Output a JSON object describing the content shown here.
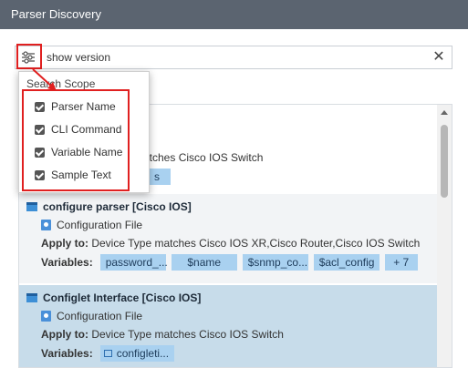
{
  "window": {
    "title": "Parser Discovery"
  },
  "search": {
    "value": "show version",
    "placeholder": ""
  },
  "scope_menu": {
    "title": "Search Scope",
    "options": [
      {
        "label": "Parser Name",
        "checked": true
      },
      {
        "label": "CLI Command",
        "checked": true
      },
      {
        "label": "Variable Name",
        "checked": true
      },
      {
        "label": "Sample Text",
        "checked": true
      }
    ]
  },
  "results": [
    {
      "title": "",
      "type": "",
      "apply_label": "",
      "apply_to": "atches Cisco IOS Switch",
      "vars_label": "",
      "variables": [
        "s"
      ]
    },
    {
      "title": "configure parser [Cisco IOS]",
      "type": "Configuration File",
      "apply_label": "Apply to:",
      "apply_to": "Device Type matches Cisco IOS XR,Cisco Router,Cisco IOS Switch",
      "vars_label": "Variables:",
      "variables": [
        "password_...",
        "$name",
        "$snmp_co...",
        "$acl_config",
        "+ 7"
      ]
    },
    {
      "title": "Configlet Interface [Cisco IOS]",
      "type": "Configuration File",
      "apply_label": "Apply to:",
      "apply_to": "Device Type matches Cisco IOS Switch",
      "vars_label": "Variables:",
      "variables": [
        "configleti..."
      ]
    }
  ],
  "colors": {
    "highlight": "#e02020",
    "chip": "#a9d1f0",
    "titlebar": "#5b6470",
    "selected_row": "#c7dcea"
  }
}
